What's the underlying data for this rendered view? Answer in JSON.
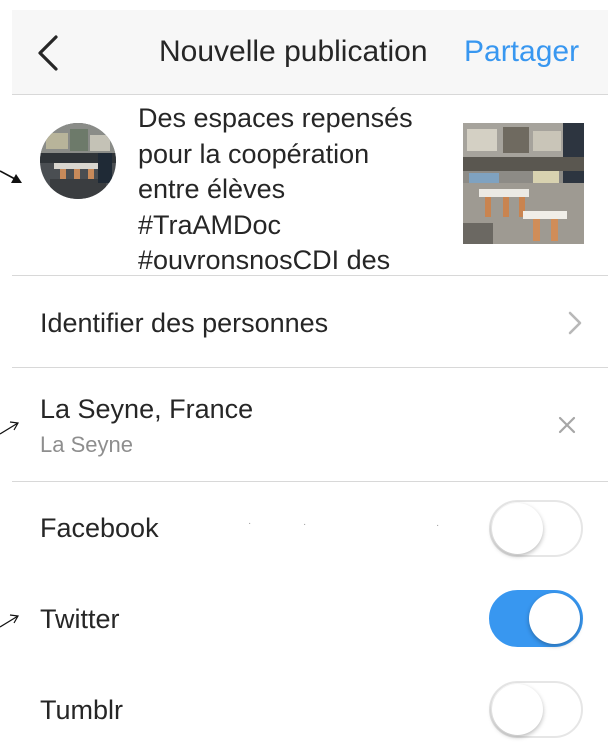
{
  "header": {
    "title": "Nouvelle publication",
    "share_label": "Partager",
    "back_icon": "chevron-left-icon"
  },
  "post": {
    "caption": "Des espaces repensés\npour la coopération\nentre élèves\n#TraAMDoc\n#ouvronsnosCDI des"
  },
  "tag_people": {
    "label": "Identifier des personnes",
    "icon": "chevron-right-icon"
  },
  "location": {
    "name": "La Seyne, France",
    "sub": "La Seyne",
    "clear_icon": "close-icon"
  },
  "share_to": [
    {
      "label": "Facebook",
      "enabled": false
    },
    {
      "label": "Twitter",
      "enabled": true
    },
    {
      "label": "Tumblr",
      "enabled": false
    }
  ],
  "colors": {
    "accent": "#3897f0",
    "header_bg": "#f7f7f7",
    "divider": "#d8d8d8",
    "secondary_text": "#8e8e8e"
  }
}
